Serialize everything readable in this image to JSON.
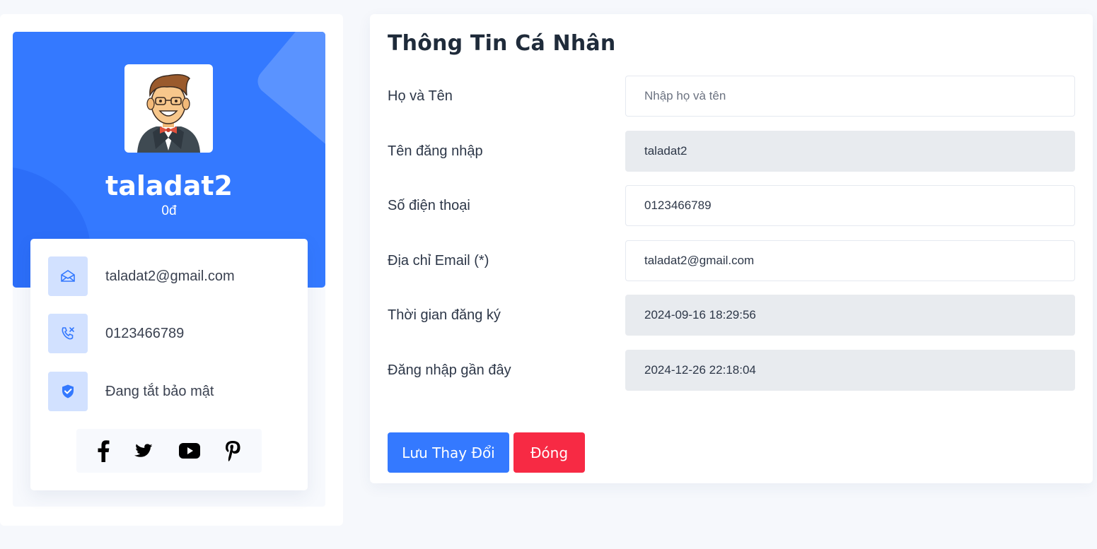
{
  "profile": {
    "username": "taladat2",
    "balance": "0đ",
    "email": "taladat2@gmail.com",
    "phone": "0123466789",
    "security_status": "Đang tắt bảo mật",
    "social": [
      "facebook-icon",
      "twitter-icon",
      "youtube-icon",
      "pinterest-icon"
    ]
  },
  "form": {
    "title": "Thông Tin Cá Nhân",
    "fields": [
      {
        "label": "Họ và Tên",
        "value": "",
        "placeholder": "Nhập họ và tên",
        "disabled": false
      },
      {
        "label": "Tên đăng nhập",
        "value": "taladat2",
        "placeholder": "",
        "disabled": true
      },
      {
        "label": "Số điện thoại",
        "value": "0123466789",
        "placeholder": "",
        "disabled": false
      },
      {
        "label": "Địa chỉ Email (*)",
        "value": "taladat2@gmail.com",
        "placeholder": "",
        "disabled": false
      },
      {
        "label": "Thời gian đăng ký",
        "value": "2024-09-16 18:29:56",
        "placeholder": "",
        "disabled": true
      },
      {
        "label": "Đăng nhập gần đây",
        "value": "2024-12-26 22:18:04",
        "placeholder": "",
        "disabled": true
      }
    ],
    "save_label": "Lưu Thay Đổi",
    "close_label": "Đóng"
  },
  "colors": {
    "primary": "#3479ff",
    "danger": "#f72a44",
    "icon_bg": "#d2e1ff",
    "disabled_input": "#e8ebef"
  }
}
